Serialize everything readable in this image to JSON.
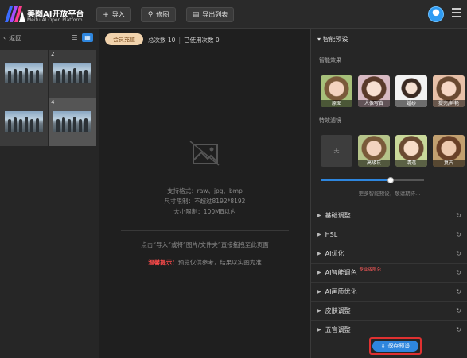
{
  "brand": {
    "title": "美图AI开放平台",
    "subtitle": "Meitu AI Open Platform"
  },
  "toolbar": {
    "import_label": "导入",
    "retouch_label": "修图",
    "export_list_label": "导出列表"
  },
  "left": {
    "back_label": "返回",
    "view_modes": [
      "list-view",
      "grid-view"
    ],
    "active_view": "grid-view",
    "thumbnails": [
      {
        "num": "1"
      },
      {
        "num": "2"
      },
      {
        "num": "3"
      },
      {
        "num": "4",
        "selected": true
      }
    ]
  },
  "center": {
    "vip_label": "会员充值",
    "total_count": "总次数 10",
    "used_count": "已使用次数 0",
    "formats": "支持格式：raw、jpg、bmp",
    "size_limit": "尺寸限制：不超过8192*8192",
    "file_limit": "大小限制：100MB以内",
    "drop_hint": "点击“导入”或将“图片/文件夹”直接拖拽至此页面",
    "warn_label": "温馨提示：",
    "warn_text": "预览仅供参考，结果以实图为准"
  },
  "right": {
    "section_title": "智能预设",
    "effects_label": "智能效果",
    "effects": [
      "原图",
      "人像写真",
      "婚纱",
      "提亮/鲜艳"
    ],
    "filters_label": "特效滤镜",
    "filters": [
      "无",
      "高级灰",
      "清透",
      "复古"
    ],
    "slider_value": 0.68,
    "more_hint": "更多智能预设，敬请期待...",
    "rows": [
      {
        "label": "基础调整",
        "tag": ""
      },
      {
        "label": "HSL",
        "tag": ""
      },
      {
        "label": "AI优化",
        "tag": ""
      },
      {
        "label": "AI智能调色",
        "tag": "专业版限免"
      },
      {
        "label": "AI画质优化",
        "tag": ""
      },
      {
        "label": "皮肤调整",
        "tag": ""
      },
      {
        "label": "五官调整",
        "tag": ""
      }
    ],
    "save_label": "保存预设"
  },
  "colors": {
    "accent": "#2e86de",
    "warn": "#ff4b4b",
    "vip_bg": "#f1d3ad"
  }
}
